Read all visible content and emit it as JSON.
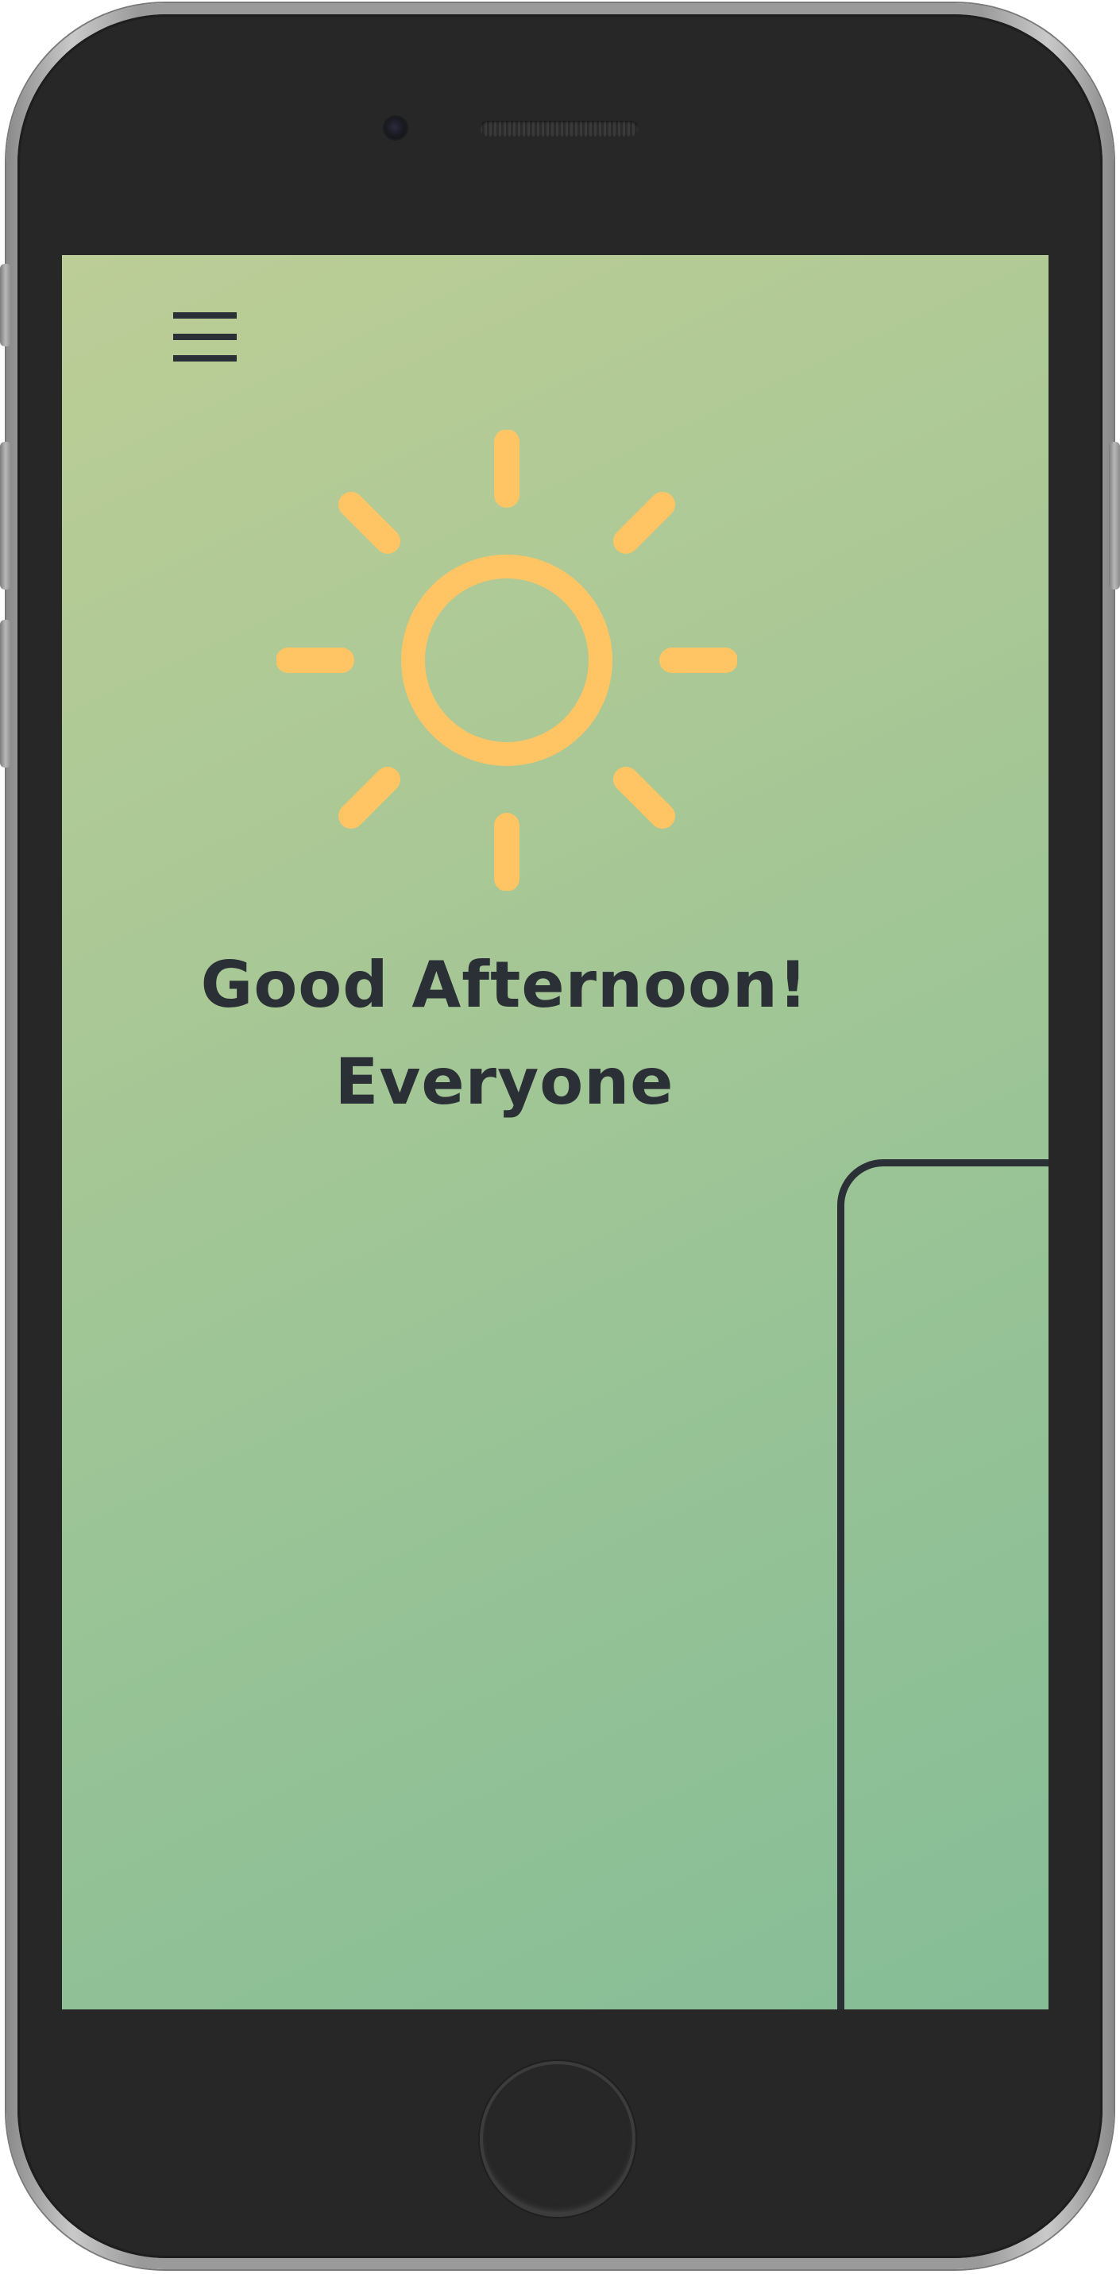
{
  "device": {
    "frame_color": "#272727",
    "bezel_color": "#9a9a9a"
  },
  "header": {
    "menu_icon": "hamburger-menu-icon"
  },
  "hero": {
    "icon": "sun-icon",
    "icon_color": "#ffc564",
    "greeting_line1": "Good Afternoon!",
    "greeting_line2": "Everyone",
    "text_color": "#2a3036"
  },
  "theme": {
    "gradient_start": "#bccd97",
    "gradient_end": "#86bd96"
  }
}
